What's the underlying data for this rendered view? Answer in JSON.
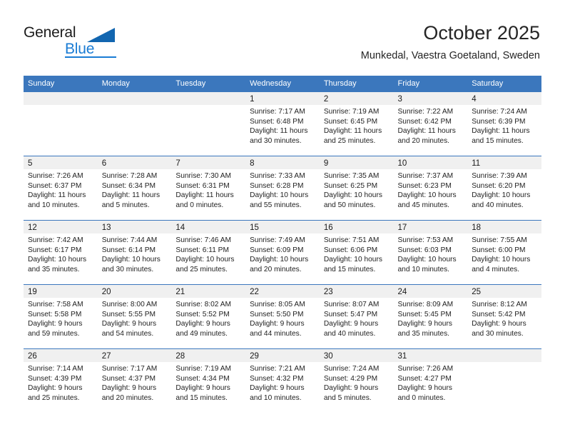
{
  "brand": {
    "name_part1": "General",
    "name_part2": "Blue"
  },
  "header": {
    "title": "October 2025",
    "subtitle": "Munkedal, Vaestra Goetaland, Sweden"
  },
  "calendar": {
    "weekday_headers": [
      "Sunday",
      "Monday",
      "Tuesday",
      "Wednesday",
      "Thursday",
      "Friday",
      "Saturday"
    ],
    "labels": {
      "sunrise": "Sunrise:",
      "sunset": "Sunset:",
      "daylight": "Daylight:"
    },
    "weeks": [
      [
        {
          "day": "",
          "empty": true
        },
        {
          "day": "",
          "empty": true
        },
        {
          "day": "",
          "empty": true
        },
        {
          "day": "1",
          "sunrise": "Sunrise: 7:17 AM",
          "sunset": "Sunset: 6:48 PM",
          "daylight": "Daylight: 11 hours and 30 minutes."
        },
        {
          "day": "2",
          "sunrise": "Sunrise: 7:19 AM",
          "sunset": "Sunset: 6:45 PM",
          "daylight": "Daylight: 11 hours and 25 minutes."
        },
        {
          "day": "3",
          "sunrise": "Sunrise: 7:22 AM",
          "sunset": "Sunset: 6:42 PM",
          "daylight": "Daylight: 11 hours and 20 minutes."
        },
        {
          "day": "4",
          "sunrise": "Sunrise: 7:24 AM",
          "sunset": "Sunset: 6:39 PM",
          "daylight": "Daylight: 11 hours and 15 minutes."
        }
      ],
      [
        {
          "day": "5",
          "sunrise": "Sunrise: 7:26 AM",
          "sunset": "Sunset: 6:37 PM",
          "daylight": "Daylight: 11 hours and 10 minutes."
        },
        {
          "day": "6",
          "sunrise": "Sunrise: 7:28 AM",
          "sunset": "Sunset: 6:34 PM",
          "daylight": "Daylight: 11 hours and 5 minutes."
        },
        {
          "day": "7",
          "sunrise": "Sunrise: 7:30 AM",
          "sunset": "Sunset: 6:31 PM",
          "daylight": "Daylight: 11 hours and 0 minutes."
        },
        {
          "day": "8",
          "sunrise": "Sunrise: 7:33 AM",
          "sunset": "Sunset: 6:28 PM",
          "daylight": "Daylight: 10 hours and 55 minutes."
        },
        {
          "day": "9",
          "sunrise": "Sunrise: 7:35 AM",
          "sunset": "Sunset: 6:25 PM",
          "daylight": "Daylight: 10 hours and 50 minutes."
        },
        {
          "day": "10",
          "sunrise": "Sunrise: 7:37 AM",
          "sunset": "Sunset: 6:23 PM",
          "daylight": "Daylight: 10 hours and 45 minutes."
        },
        {
          "day": "11",
          "sunrise": "Sunrise: 7:39 AM",
          "sunset": "Sunset: 6:20 PM",
          "daylight": "Daylight: 10 hours and 40 minutes."
        }
      ],
      [
        {
          "day": "12",
          "sunrise": "Sunrise: 7:42 AM",
          "sunset": "Sunset: 6:17 PM",
          "daylight": "Daylight: 10 hours and 35 minutes."
        },
        {
          "day": "13",
          "sunrise": "Sunrise: 7:44 AM",
          "sunset": "Sunset: 6:14 PM",
          "daylight": "Daylight: 10 hours and 30 minutes."
        },
        {
          "day": "14",
          "sunrise": "Sunrise: 7:46 AM",
          "sunset": "Sunset: 6:11 PM",
          "daylight": "Daylight: 10 hours and 25 minutes."
        },
        {
          "day": "15",
          "sunrise": "Sunrise: 7:49 AM",
          "sunset": "Sunset: 6:09 PM",
          "daylight": "Daylight: 10 hours and 20 minutes."
        },
        {
          "day": "16",
          "sunrise": "Sunrise: 7:51 AM",
          "sunset": "Sunset: 6:06 PM",
          "daylight": "Daylight: 10 hours and 15 minutes."
        },
        {
          "day": "17",
          "sunrise": "Sunrise: 7:53 AM",
          "sunset": "Sunset: 6:03 PM",
          "daylight": "Daylight: 10 hours and 10 minutes."
        },
        {
          "day": "18",
          "sunrise": "Sunrise: 7:55 AM",
          "sunset": "Sunset: 6:00 PM",
          "daylight": "Daylight: 10 hours and 4 minutes."
        }
      ],
      [
        {
          "day": "19",
          "sunrise": "Sunrise: 7:58 AM",
          "sunset": "Sunset: 5:58 PM",
          "daylight": "Daylight: 9 hours and 59 minutes."
        },
        {
          "day": "20",
          "sunrise": "Sunrise: 8:00 AM",
          "sunset": "Sunset: 5:55 PM",
          "daylight": "Daylight: 9 hours and 54 minutes."
        },
        {
          "day": "21",
          "sunrise": "Sunrise: 8:02 AM",
          "sunset": "Sunset: 5:52 PM",
          "daylight": "Daylight: 9 hours and 49 minutes."
        },
        {
          "day": "22",
          "sunrise": "Sunrise: 8:05 AM",
          "sunset": "Sunset: 5:50 PM",
          "daylight": "Daylight: 9 hours and 44 minutes."
        },
        {
          "day": "23",
          "sunrise": "Sunrise: 8:07 AM",
          "sunset": "Sunset: 5:47 PM",
          "daylight": "Daylight: 9 hours and 40 minutes."
        },
        {
          "day": "24",
          "sunrise": "Sunrise: 8:09 AM",
          "sunset": "Sunset: 5:45 PM",
          "daylight": "Daylight: 9 hours and 35 minutes."
        },
        {
          "day": "25",
          "sunrise": "Sunrise: 8:12 AM",
          "sunset": "Sunset: 5:42 PM",
          "daylight": "Daylight: 9 hours and 30 minutes."
        }
      ],
      [
        {
          "day": "26",
          "sunrise": "Sunrise: 7:14 AM",
          "sunset": "Sunset: 4:39 PM",
          "daylight": "Daylight: 9 hours and 25 minutes."
        },
        {
          "day": "27",
          "sunrise": "Sunrise: 7:17 AM",
          "sunset": "Sunset: 4:37 PM",
          "daylight": "Daylight: 9 hours and 20 minutes."
        },
        {
          "day": "28",
          "sunrise": "Sunrise: 7:19 AM",
          "sunset": "Sunset: 4:34 PM",
          "daylight": "Daylight: 9 hours and 15 minutes."
        },
        {
          "day": "29",
          "sunrise": "Sunrise: 7:21 AM",
          "sunset": "Sunset: 4:32 PM",
          "daylight": "Daylight: 9 hours and 10 minutes."
        },
        {
          "day": "30",
          "sunrise": "Sunrise: 7:24 AM",
          "sunset": "Sunset: 4:29 PM",
          "daylight": "Daylight: 9 hours and 5 minutes."
        },
        {
          "day": "31",
          "sunrise": "Sunrise: 7:26 AM",
          "sunset": "Sunset: 4:27 PM",
          "daylight": "Daylight: 9 hours and 0 minutes."
        },
        {
          "day": "",
          "empty": true
        }
      ]
    ]
  },
  "colors": {
    "header_blue": "#3b77bd",
    "brand_blue": "#1a7cd4",
    "logo_triangle": "#1266b0",
    "cell_head_bg": "#f0f0f0"
  }
}
